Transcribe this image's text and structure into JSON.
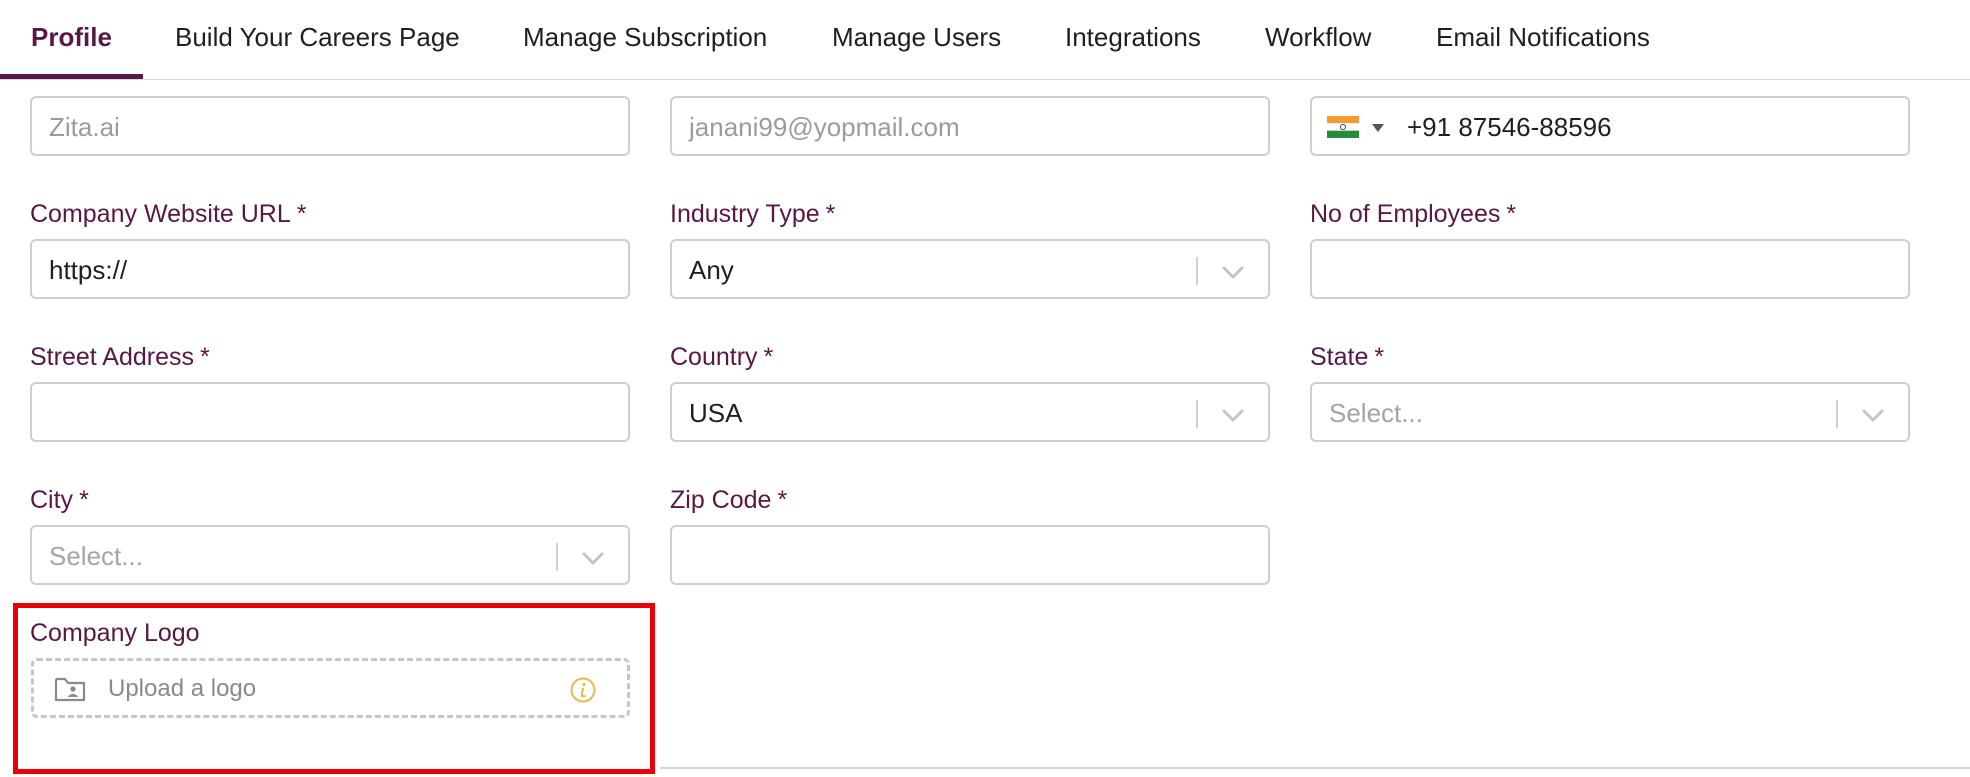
{
  "tabs": [
    {
      "label": "Profile",
      "active": true
    },
    {
      "label": "Build Your Careers Page"
    },
    {
      "label": "Manage Subscription"
    },
    {
      "label": "Manage Users"
    },
    {
      "label": "Integrations"
    },
    {
      "label": "Workflow"
    },
    {
      "label": "Email Notifications"
    }
  ],
  "colors": {
    "accent": "#581845",
    "highlight": "#e8000b",
    "info": "#e9b949"
  },
  "form": {
    "company_name": {
      "value": "Zita.ai"
    },
    "email": {
      "value": "janani99@yopmail.com"
    },
    "contact": {
      "flag_icon": "india-flag-icon",
      "value": "+91 87546-88596"
    },
    "website": {
      "label": "Company Website URL",
      "value": "https://"
    },
    "industry": {
      "label": "Industry Type",
      "value": "Any"
    },
    "employees": {
      "label": "No of Employees",
      "value": ""
    },
    "street": {
      "label": "Street Address",
      "value": ""
    },
    "country": {
      "label": "Country",
      "value": "USA"
    },
    "state": {
      "label": "State",
      "placeholder": "Select..."
    },
    "city": {
      "label": "City",
      "placeholder": "Select..."
    },
    "zip": {
      "label": "Zip Code",
      "value": ""
    },
    "logo": {
      "label": "Company Logo",
      "upload_text": "Upload a logo",
      "icon": "folder-icon",
      "info_icon": "info-icon"
    },
    "required_mark": "*"
  }
}
